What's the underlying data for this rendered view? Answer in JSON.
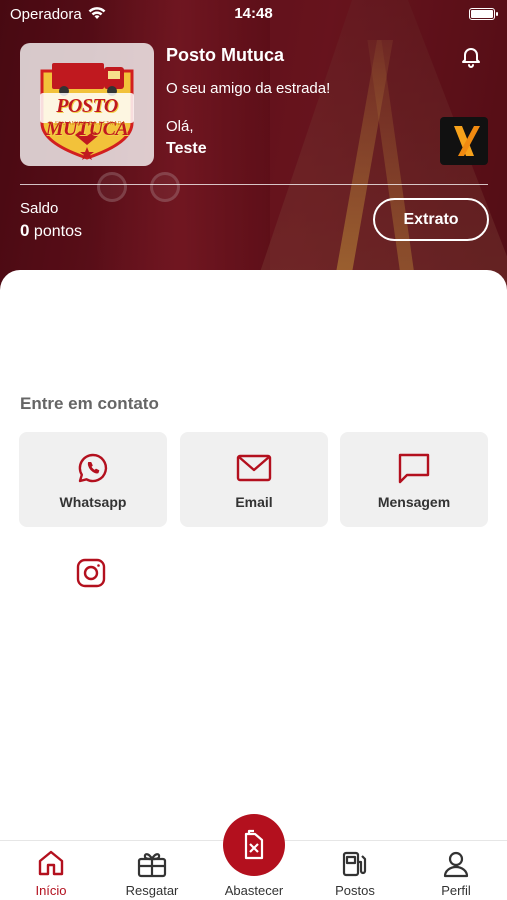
{
  "status_bar": {
    "carrier": "Operadora",
    "time": "14:48"
  },
  "header": {
    "logo_text": "POSTO MUTUCA",
    "logo_subtext": "O SEU AMIGO DA ESTRADA",
    "station_name": "Posto Mutuca",
    "slogan": "O seu amigo da estrada!",
    "greeting": "Olá,",
    "username": "Teste",
    "balance_label": "Saldo",
    "balance_value": "0",
    "balance_unit": "pontos",
    "statement_button": "Extrato"
  },
  "contact": {
    "title": "Entre em contato",
    "cards": [
      {
        "label": "Whatsapp",
        "icon": "whatsapp-icon"
      },
      {
        "label": "Email",
        "icon": "email-icon"
      },
      {
        "label": "Mensagem",
        "icon": "message-icon"
      }
    ],
    "social_icon": "instagram-icon"
  },
  "tab_bar": {
    "tabs": [
      {
        "label": "Início",
        "icon": "home-icon",
        "active": true
      },
      {
        "label": "Resgatar",
        "icon": "gift-icon",
        "active": false
      },
      {
        "label": "Abastecer",
        "icon": "fuel-can-icon",
        "active": false
      },
      {
        "label": "Postos",
        "icon": "fuel-station-icon",
        "active": false
      },
      {
        "label": "Perfil",
        "icon": "user-icon",
        "active": false
      }
    ]
  },
  "colors": {
    "accent": "#b3101e",
    "header_bg": "#6e1420",
    "card_bg": "#f0f0f0"
  }
}
